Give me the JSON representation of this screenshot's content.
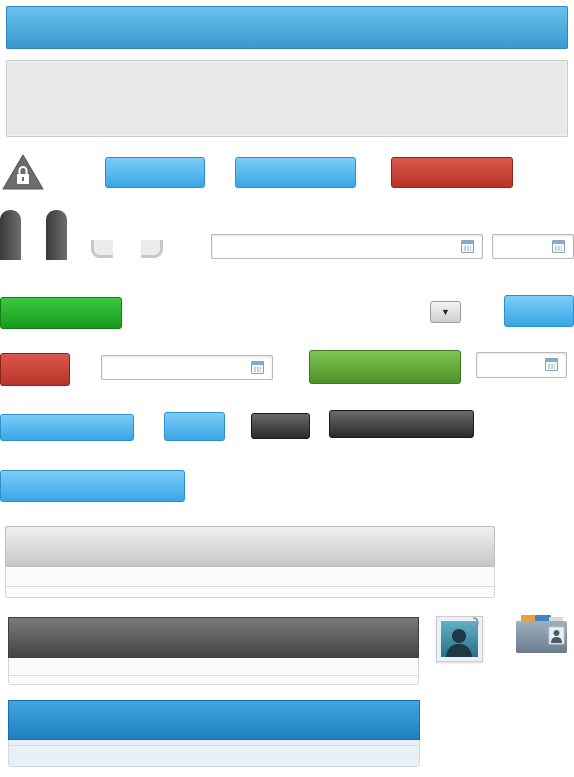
{
  "icons": {
    "warning_lock": "lock-warning-icon",
    "calendar": "calendar-icon",
    "dropdown": "triangle-down-icon",
    "user_photo": "user-photo-icon",
    "contact_folder": "contact-folder-icon"
  },
  "colors": {
    "header_blue": "#3a98cd",
    "button_blue": "#3aa6e6",
    "button_red": "#b8342a",
    "button_green": "#1a9a1f",
    "button_green_alt": "#4e922a",
    "button_dark": "#2a2a2a",
    "panel_grey": "#c7c7c7",
    "panel_dark": "#454545",
    "panel_blue": "#1f80bf"
  },
  "dropdown": {
    "arrow": "▼"
  }
}
